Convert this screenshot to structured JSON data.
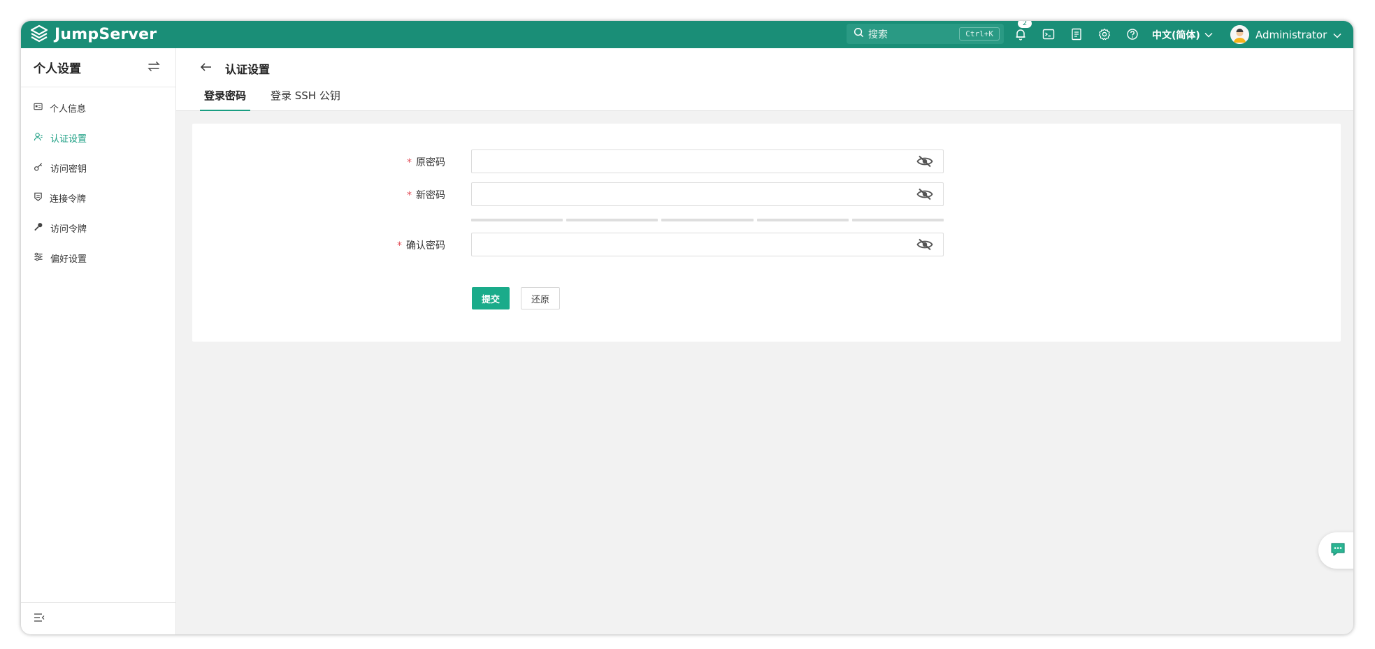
{
  "topbar": {
    "brand": "JumpServer",
    "search_placeholder": "搜索",
    "search_shortcut": "Ctrl+K",
    "notification_count": "2",
    "language": "中文(简体)",
    "user_name": "Administrator"
  },
  "sidebar": {
    "title": "个人设置",
    "items": [
      {
        "label": "个人信息",
        "icon": "id-card-icon"
      },
      {
        "label": "认证设置",
        "icon": "user-auth-icon",
        "active": true
      },
      {
        "label": "访问密钥",
        "icon": "key-icon"
      },
      {
        "label": "连接令牌",
        "icon": "shield-token-icon"
      },
      {
        "label": "访问令牌",
        "icon": "wrench-key-icon"
      },
      {
        "label": "偏好设置",
        "icon": "sliders-icon"
      }
    ]
  },
  "page": {
    "title": "认证设置",
    "tabs": [
      {
        "label": "登录密码",
        "active": true
      },
      {
        "label": "登录 SSH 公钥",
        "active": false
      }
    ]
  },
  "form": {
    "old_password_label": "原密码",
    "new_password_label": "新密码",
    "confirm_password_label": "确认密码",
    "required_mark": "*",
    "old_password_value": "",
    "new_password_value": "",
    "confirm_password_value": "",
    "submit_label": "提交",
    "reset_label": "还原"
  },
  "colors": {
    "brand": "#1a8e77",
    "accent": "#1aab8a",
    "required": "#e2505a"
  }
}
